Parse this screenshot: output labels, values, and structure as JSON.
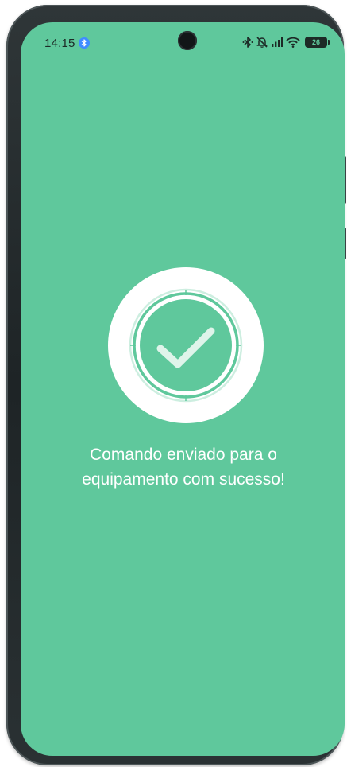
{
  "status_bar": {
    "time": "14:15",
    "battery_level": "26",
    "battery_percent": 26,
    "icons": [
      "bluetooth-icon",
      "mute-icon",
      "signal-icon",
      "wifi-icon",
      "battery-icon"
    ]
  },
  "success": {
    "icon": "checkmark-icon",
    "message": "Comando enviado para o equipamento com sucesso!"
  },
  "colors": {
    "background": "#5fc89c",
    "badge": "#ffffff",
    "bluetooth_indicator": "#3f8cff"
  }
}
